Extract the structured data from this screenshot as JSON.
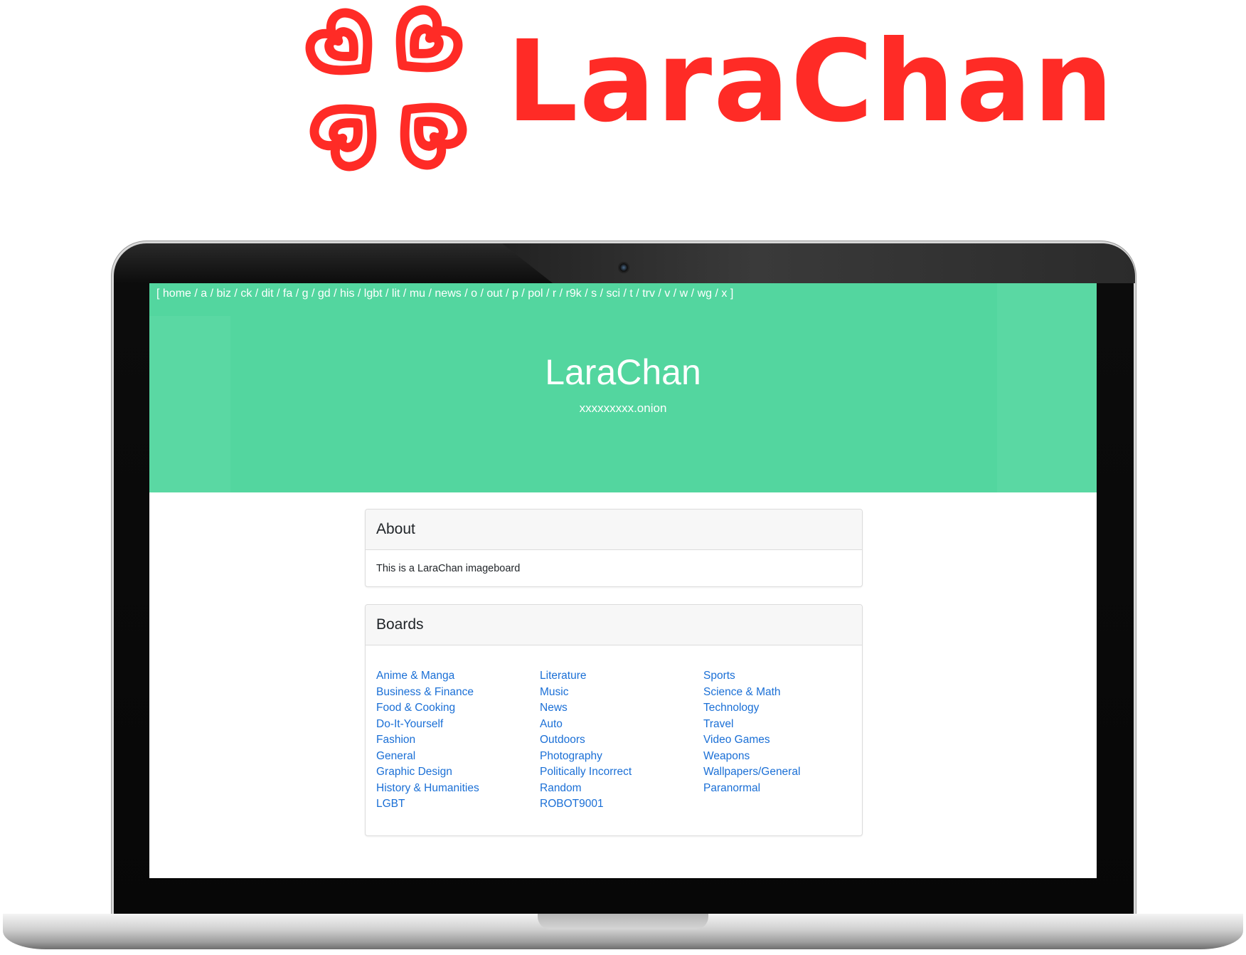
{
  "brand": {
    "name": "LaraChan",
    "color": "#ff2b26",
    "logo_icon": "four-hearts-logo-icon"
  },
  "nav": {
    "open": "[",
    "close": "]",
    "separator": " / ",
    "items": [
      "home",
      "a",
      "biz",
      "ck",
      "dit",
      "fa",
      "g",
      "gd",
      "his",
      "lgbt",
      "lit",
      "mu",
      "news",
      "o",
      "out",
      "p",
      "pol",
      "r",
      "r9k",
      "s",
      "sci",
      "t",
      "trv",
      "v",
      "w",
      "wg",
      "x"
    ]
  },
  "hero": {
    "title": "LaraChan",
    "subtitle": "xxxxxxxxx.onion",
    "color": "#53d69f"
  },
  "about": {
    "heading": "About",
    "text": "This is a LaraChan imageboard"
  },
  "boards": {
    "heading": "Boards",
    "link_color": "#1a6fd6",
    "columns": [
      [
        "Anime & Manga",
        "Business & Finance",
        "Food & Cooking",
        "Do-It-Yourself",
        "Fashion",
        "General",
        "Graphic Design",
        "History & Humanities",
        "LGBT"
      ],
      [
        "Literature",
        "Music",
        "News",
        "Auto",
        "Outdoors",
        "Photography",
        "Politically Incorrect",
        "Random",
        "ROBOT9001"
      ],
      [
        "Sports",
        "Science & Math",
        "Technology",
        "Travel",
        "Video Games",
        "Weapons",
        "Wallpapers/General",
        "Paranormal"
      ]
    ]
  }
}
